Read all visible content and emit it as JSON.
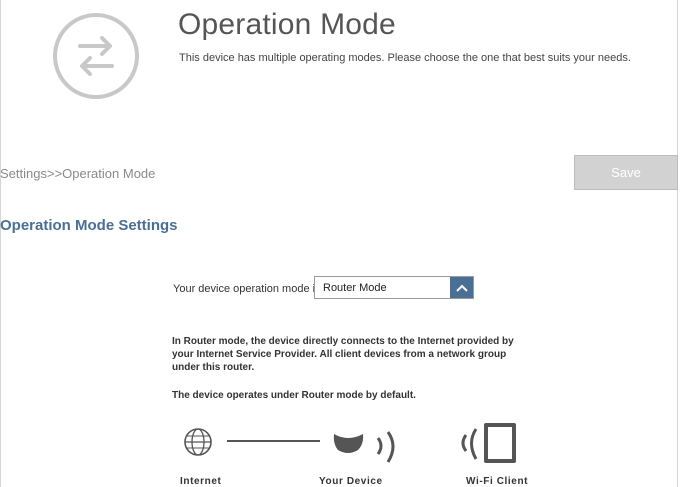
{
  "header": {
    "title": "Operation Mode",
    "description": "This device has multiple operating modes. Please choose the one that best suits your needs."
  },
  "breadcrumb": "Settings>>Operation Mode",
  "save_label": "Save",
  "section_title": "Operation Mode Settings",
  "mode_field": {
    "label": "Your device operation mode is:",
    "value": "Router Mode"
  },
  "mode_description": "In Router mode, the device directly connects to the Internet provided by your Internet Service Provider. All client devices from a network group under this router.",
  "default_note": "The device operates under Router mode by default.",
  "diagram": {
    "internet_label": "Internet",
    "device_label": "Your Device",
    "client_label": "Wi-Fi Client"
  },
  "colors": {
    "accent": "#4a6f95",
    "save_bg": "#d2d2d2"
  }
}
